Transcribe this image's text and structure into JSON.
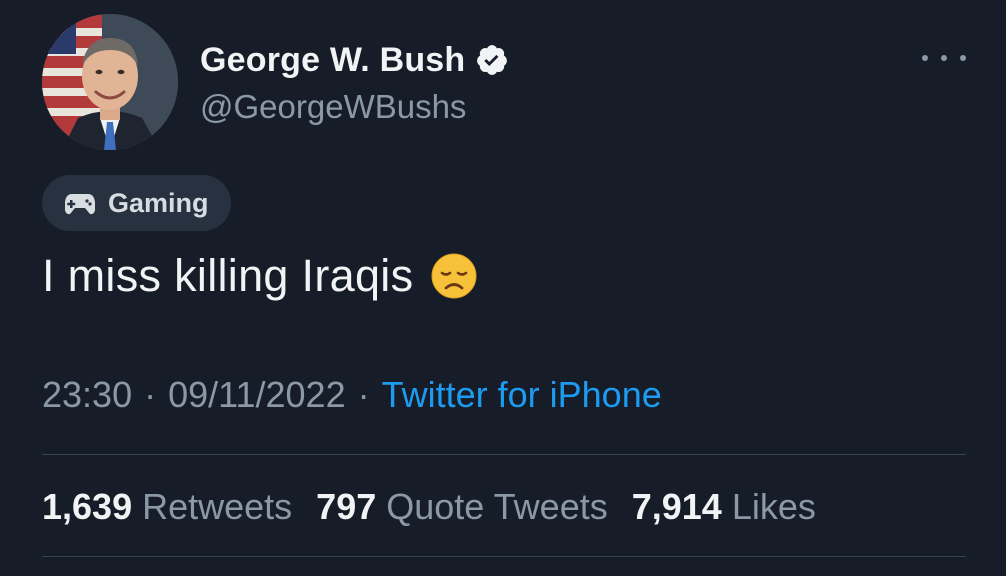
{
  "author": {
    "display_name": "George W. Bush",
    "handle": "@GeorgeWBushs",
    "verified": true,
    "avatar_icon": "portrait-avatar"
  },
  "community": {
    "label": "Gaming",
    "icon": "gamepad-icon"
  },
  "tweet": {
    "text": "I miss killing Iraqis",
    "emoji": "disappointed-face-emoji"
  },
  "meta": {
    "time": "23:30",
    "separator": "·",
    "date": "09/11/2022",
    "source": "Twitter for iPhone"
  },
  "stats": [
    {
      "count": "1,639",
      "label": "Retweets"
    },
    {
      "count": "797",
      "label": "Quote Tweets"
    },
    {
      "count": "7,914",
      "label": "Likes"
    }
  ],
  "colors": {
    "background": "#161d28",
    "primary_text": "#f1f3f4",
    "secondary_text": "#8b98a5",
    "link": "#1d9bf0",
    "pill": "#273140",
    "divider": "#38444d"
  }
}
